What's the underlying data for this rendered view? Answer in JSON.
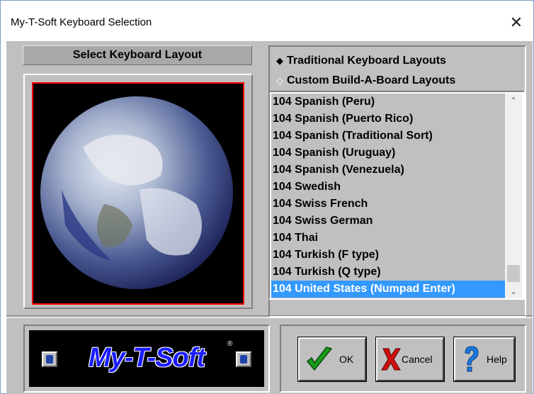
{
  "window": {
    "title": "My-T-Soft Keyboard Selection",
    "close_label": "✕"
  },
  "left_panel": {
    "header": "Select Keyboard Layout",
    "image": "earth-globe"
  },
  "layout_options": {
    "traditional_label": "Traditional Keyboard Layouts",
    "custom_label": "Custom Build-A-Board Layouts",
    "selected": "traditional"
  },
  "layout_list": {
    "items": [
      "104 Spanish (Peru)",
      "104 Spanish (Puerto Rico)",
      "104 Spanish (Traditional Sort)",
      "104 Spanish (Uruguay)",
      "104 Spanish (Venezuela)",
      "104 Swedish",
      "104 Swiss French",
      "104 Swiss German",
      "104 Thai",
      "104 Turkish (F type)",
      "104 Turkish (Q type)",
      "104 United States (Numpad Enter)"
    ],
    "selected_index": 11
  },
  "logo": {
    "text": "My-T-Soft",
    "reg_mark": "®"
  },
  "buttons": {
    "ok_label": "OK",
    "cancel_label": "Cancel",
    "help_label": "Help"
  },
  "colors": {
    "selection": "#3399ff",
    "logo_text": "#1c1cff",
    "dialog_bg": "#c0c0c0"
  }
}
